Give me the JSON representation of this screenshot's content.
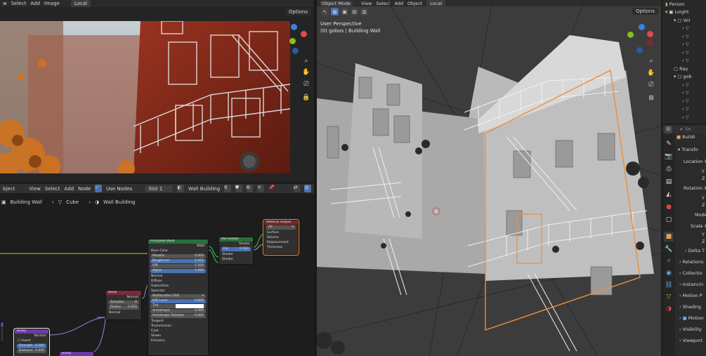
{
  "render_header": {
    "items": [
      "w",
      "Select",
      "Add",
      "Image"
    ],
    "view_mode": "Local",
    "options_label": "Options"
  },
  "node_header": {
    "editor_type": "bject",
    "menu": [
      "View",
      "Select",
      "Add",
      "Node"
    ],
    "use_nodes_label": "Use Nodes",
    "slot_label": "Slot 1",
    "material_name": "Wall Building",
    "user_count": "6"
  },
  "node_breadcrumb": {
    "object": "Building Wall",
    "mesh": "Cube",
    "material": "Wall Building"
  },
  "nodes": {
    "principled": {
      "title": "Principled BSDF",
      "out_label": "BSDF",
      "base_color": "Base Color",
      "metallic": {
        "label": "Metallic",
        "value": "0.000"
      },
      "roughness": {
        "label": "Roughness",
        "value": "0.452"
      },
      "ior": {
        "label": "IOR",
        "value": "1.500"
      },
      "alpha": {
        "label": "Alpha",
        "value": "1.000"
      },
      "normal": "Normal",
      "diffuse": "Diffuse",
      "subsurface": "Subsurface",
      "specular": "Specular",
      "distribution": "Multiscatter GGX",
      "ior_level": {
        "label": "IOR Level",
        "value": "0.600"
      },
      "tint": "Tint",
      "anisotropic": {
        "label": "Anisotropic",
        "value": "0.000"
      },
      "aniso_rot": {
        "label": "Anisotropic Rotation",
        "value": "0.000"
      },
      "tangent": "Tangent",
      "transmission": "Transmission",
      "coat": "Coat",
      "sheen": "Sheen",
      "emission": "Emission"
    },
    "mix_shader": {
      "title": "Mix Shader",
      "shader_out": "Shader",
      "fac": {
        "label": "Fac",
        "value": "0.500"
      },
      "shader1": "Shader",
      "shader2": "Shader"
    },
    "material_output": {
      "title": "Material Output",
      "target": "All",
      "surface": "Surface",
      "volume": "Volume",
      "displacement": "Displacement",
      "thickness": "Thickness"
    },
    "bevel": {
      "title": "Bevel",
      "out": "Normal",
      "samples": {
        "label": "Samples",
        "value": "8"
      },
      "radius": {
        "label": "Radius",
        "value": "0.050"
      },
      "normal_in": "Normal"
    },
    "bump1": {
      "title": "Bump",
      "out": "Normal",
      "invert": "Invert",
      "strength": {
        "label": "Strength",
        "value": "0.180"
      },
      "distance": {
        "label": "Distance",
        "value": "1.000"
      }
    },
    "bump2": {
      "title": "Bump"
    }
  },
  "viewport_header": {
    "mode": "Object Mode",
    "menu": [
      "View",
      "Select",
      "Add",
      "Object"
    ],
    "orientation": "Local",
    "options_label": "Options"
  },
  "viewport_overlay": {
    "perspective": "User Perspective",
    "object_info": "(0) gobos | Building Wall"
  },
  "gizmo": {
    "x_color": "#e5474e",
    "y_color": "#8bbc1b",
    "z_color": "#3d7fe0",
    "labels": {
      "x": "X",
      "y": "Y",
      "z": "Z"
    }
  },
  "outliner": {
    "items": [
      {
        "label": "Person"
      },
      {
        "label": "Loight"
      },
      {
        "label": "Vol"
      },
      {
        "label": ""
      },
      {
        "label": ""
      },
      {
        "label": ""
      },
      {
        "label": ""
      },
      {
        "label": ""
      },
      {
        "label": "Ray"
      },
      {
        "label": "gob"
      },
      {
        "label": ""
      },
      {
        "label": ""
      },
      {
        "label": ""
      },
      {
        "label": ""
      },
      {
        "label": ""
      }
    ]
  },
  "properties": {
    "search_placeholder": "Se",
    "object_name": "Buildi",
    "sections": [
      {
        "label": "Transfo"
      },
      {
        "label": "Location X"
      },
      {
        "label": "Y"
      },
      {
        "label": "Z"
      },
      {
        "label": "Rotation X"
      },
      {
        "label": "Y"
      },
      {
        "label": "Z"
      },
      {
        "label": "Mode"
      },
      {
        "label": "Scale X"
      },
      {
        "label": "Y"
      },
      {
        "label": "Z"
      },
      {
        "label": "Delta T"
      },
      {
        "label": "Relations"
      },
      {
        "label": "Collectio"
      },
      {
        "label": "Instancin"
      },
      {
        "label": "Motion P"
      },
      {
        "label": "Shading"
      },
      {
        "label": "Motion"
      },
      {
        "label": "Visibility"
      },
      {
        "label": "Viewport"
      }
    ]
  },
  "colors": {
    "accent": "#4772b3",
    "selection": "#ed8f3c",
    "shader_header": "#2b6e3e",
    "output_header": "#7a2727",
    "vector_header": "#6a3aa8",
    "bevel_header": "#7a2a3a"
  }
}
